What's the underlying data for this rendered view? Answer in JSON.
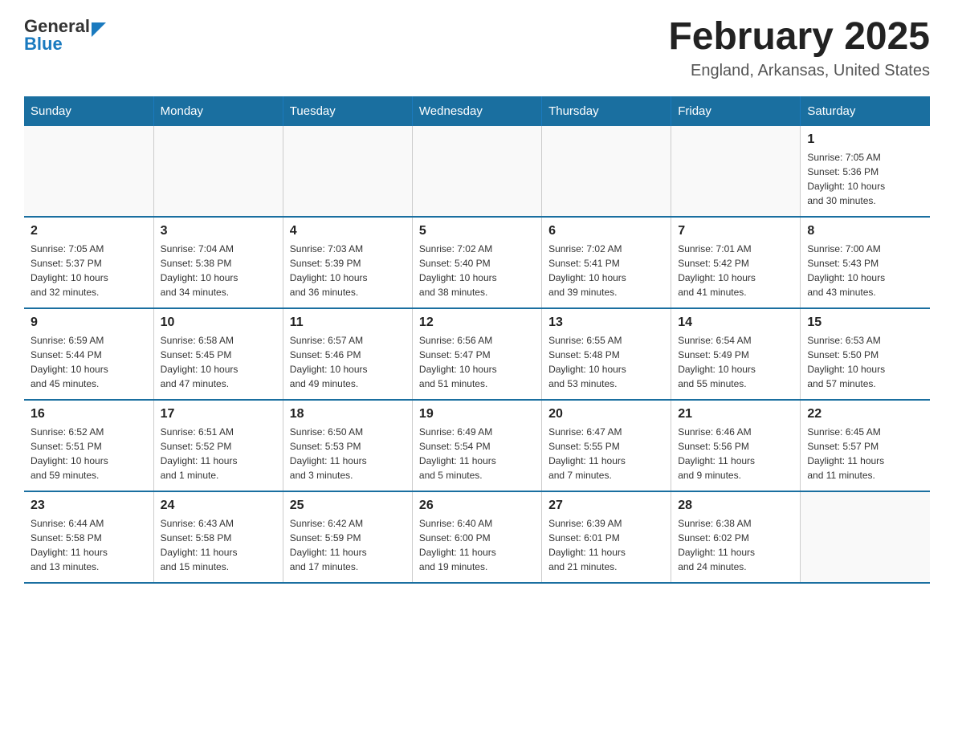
{
  "header": {
    "logo_general": "General",
    "logo_blue": "Blue",
    "title": "February 2025",
    "subtitle": "England, Arkansas, United States"
  },
  "weekdays": [
    "Sunday",
    "Monday",
    "Tuesday",
    "Wednesday",
    "Thursday",
    "Friday",
    "Saturday"
  ],
  "weeks": [
    {
      "days": [
        {
          "num": "",
          "info": ""
        },
        {
          "num": "",
          "info": ""
        },
        {
          "num": "",
          "info": ""
        },
        {
          "num": "",
          "info": ""
        },
        {
          "num": "",
          "info": ""
        },
        {
          "num": "",
          "info": ""
        },
        {
          "num": "1",
          "info": "Sunrise: 7:05 AM\nSunset: 5:36 PM\nDaylight: 10 hours\nand 30 minutes."
        }
      ]
    },
    {
      "days": [
        {
          "num": "2",
          "info": "Sunrise: 7:05 AM\nSunset: 5:37 PM\nDaylight: 10 hours\nand 32 minutes."
        },
        {
          "num": "3",
          "info": "Sunrise: 7:04 AM\nSunset: 5:38 PM\nDaylight: 10 hours\nand 34 minutes."
        },
        {
          "num": "4",
          "info": "Sunrise: 7:03 AM\nSunset: 5:39 PM\nDaylight: 10 hours\nand 36 minutes."
        },
        {
          "num": "5",
          "info": "Sunrise: 7:02 AM\nSunset: 5:40 PM\nDaylight: 10 hours\nand 38 minutes."
        },
        {
          "num": "6",
          "info": "Sunrise: 7:02 AM\nSunset: 5:41 PM\nDaylight: 10 hours\nand 39 minutes."
        },
        {
          "num": "7",
          "info": "Sunrise: 7:01 AM\nSunset: 5:42 PM\nDaylight: 10 hours\nand 41 minutes."
        },
        {
          "num": "8",
          "info": "Sunrise: 7:00 AM\nSunset: 5:43 PM\nDaylight: 10 hours\nand 43 minutes."
        }
      ]
    },
    {
      "days": [
        {
          "num": "9",
          "info": "Sunrise: 6:59 AM\nSunset: 5:44 PM\nDaylight: 10 hours\nand 45 minutes."
        },
        {
          "num": "10",
          "info": "Sunrise: 6:58 AM\nSunset: 5:45 PM\nDaylight: 10 hours\nand 47 minutes."
        },
        {
          "num": "11",
          "info": "Sunrise: 6:57 AM\nSunset: 5:46 PM\nDaylight: 10 hours\nand 49 minutes."
        },
        {
          "num": "12",
          "info": "Sunrise: 6:56 AM\nSunset: 5:47 PM\nDaylight: 10 hours\nand 51 minutes."
        },
        {
          "num": "13",
          "info": "Sunrise: 6:55 AM\nSunset: 5:48 PM\nDaylight: 10 hours\nand 53 minutes."
        },
        {
          "num": "14",
          "info": "Sunrise: 6:54 AM\nSunset: 5:49 PM\nDaylight: 10 hours\nand 55 minutes."
        },
        {
          "num": "15",
          "info": "Sunrise: 6:53 AM\nSunset: 5:50 PM\nDaylight: 10 hours\nand 57 minutes."
        }
      ]
    },
    {
      "days": [
        {
          "num": "16",
          "info": "Sunrise: 6:52 AM\nSunset: 5:51 PM\nDaylight: 10 hours\nand 59 minutes."
        },
        {
          "num": "17",
          "info": "Sunrise: 6:51 AM\nSunset: 5:52 PM\nDaylight: 11 hours\nand 1 minute."
        },
        {
          "num": "18",
          "info": "Sunrise: 6:50 AM\nSunset: 5:53 PM\nDaylight: 11 hours\nand 3 minutes."
        },
        {
          "num": "19",
          "info": "Sunrise: 6:49 AM\nSunset: 5:54 PM\nDaylight: 11 hours\nand 5 minutes."
        },
        {
          "num": "20",
          "info": "Sunrise: 6:47 AM\nSunset: 5:55 PM\nDaylight: 11 hours\nand 7 minutes."
        },
        {
          "num": "21",
          "info": "Sunrise: 6:46 AM\nSunset: 5:56 PM\nDaylight: 11 hours\nand 9 minutes."
        },
        {
          "num": "22",
          "info": "Sunrise: 6:45 AM\nSunset: 5:57 PM\nDaylight: 11 hours\nand 11 minutes."
        }
      ]
    },
    {
      "days": [
        {
          "num": "23",
          "info": "Sunrise: 6:44 AM\nSunset: 5:58 PM\nDaylight: 11 hours\nand 13 minutes."
        },
        {
          "num": "24",
          "info": "Sunrise: 6:43 AM\nSunset: 5:58 PM\nDaylight: 11 hours\nand 15 minutes."
        },
        {
          "num": "25",
          "info": "Sunrise: 6:42 AM\nSunset: 5:59 PM\nDaylight: 11 hours\nand 17 minutes."
        },
        {
          "num": "26",
          "info": "Sunrise: 6:40 AM\nSunset: 6:00 PM\nDaylight: 11 hours\nand 19 minutes."
        },
        {
          "num": "27",
          "info": "Sunrise: 6:39 AM\nSunset: 6:01 PM\nDaylight: 11 hours\nand 21 minutes."
        },
        {
          "num": "28",
          "info": "Sunrise: 6:38 AM\nSunset: 6:02 PM\nDaylight: 11 hours\nand 24 minutes."
        },
        {
          "num": "",
          "info": ""
        }
      ]
    }
  ]
}
